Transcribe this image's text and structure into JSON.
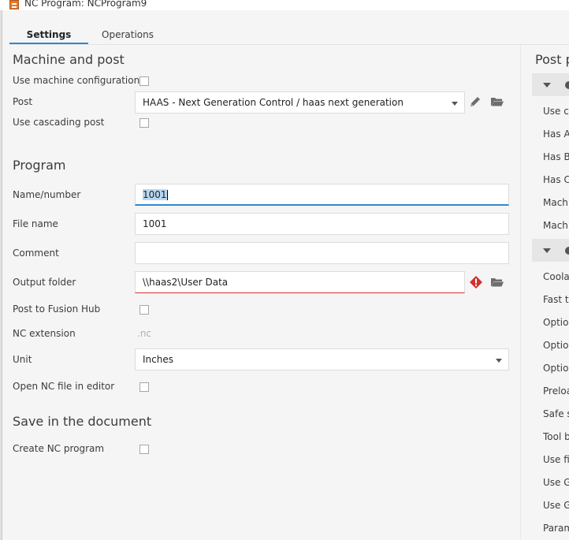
{
  "window": {
    "title": "NC Program: NCProgram9"
  },
  "tabs": [
    {
      "label": "Settings",
      "active": true
    },
    {
      "label": "Operations",
      "active": false
    }
  ],
  "machine_and_post": {
    "heading": "Machine and post",
    "use_machine_config_label": "Use machine configuration",
    "use_machine_config_checked": false,
    "post_label": "Post",
    "post_value": "HAAS - Next Generation Control / haas next generation",
    "use_cascading_label": "Use cascading post",
    "use_cascading_checked": false
  },
  "program": {
    "heading": "Program",
    "name_label": "Name/number",
    "name_value": "1001",
    "file_name_label": "File name",
    "file_name_value": "1001",
    "comment_label": "Comment",
    "comment_value": "",
    "output_folder_label": "Output folder",
    "output_folder_value": "\\\\haas2\\User Data",
    "post_to_hub_label": "Post to Fusion Hub",
    "post_to_hub_checked": false,
    "nc_extension_label": "NC extension",
    "nc_extension_value": ".nc",
    "unit_label": "Unit",
    "unit_value": "Inches",
    "open_nc_label": "Open NC file in editor",
    "open_nc_checked": false
  },
  "save_in_document": {
    "heading": "Save in the document",
    "create_nc_label": "Create NC program",
    "create_nc_checked": false
  },
  "post_properties": {
    "heading": "Post p",
    "group1_items": [
      "Use ch",
      "Has A",
      "Has B",
      "Has C",
      "Machi",
      "Machi"
    ],
    "group2_items": [
      "Coola",
      "Fast t",
      "Optio",
      "Optio",
      "Optio",
      "Preloa",
      "Safe s",
      "Tool b",
      "Use fi",
      "Use G",
      "Use G",
      "Param"
    ]
  },
  "icons": {
    "app": "fusion-app-icon",
    "edit": "pencil-icon",
    "folder": "folder-open-icon",
    "error": "error-diamond-icon",
    "dropdown": "chevron-down-icon",
    "group_toggle": "triangle-down-icon"
  },
  "colors": {
    "accent": "#2d8ad2",
    "error": "#d22f2f",
    "selection": "#b8d7f1"
  }
}
